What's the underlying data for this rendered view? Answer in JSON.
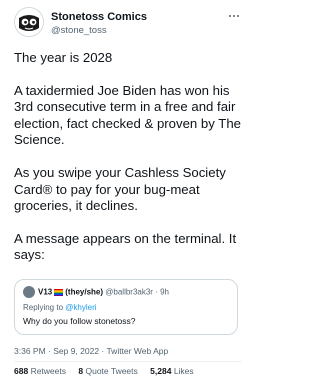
{
  "author": {
    "name": "Stonetoss Comics",
    "handle": "@stone_toss",
    "avatar_icon": "cartoon-face-avatar"
  },
  "tweet": {
    "paragraphs": [
      "The year is 2028",
      "A taxidermied Joe Biden has won his 3rd consecutive term in a free and fair election, fact checked & proven by The Science.",
      "As you swipe your Cashless Society Card® to pay for your bug-meat groceries, it declines.",
      "A message appears on the terminal. It says:"
    ]
  },
  "quote": {
    "name": "V13",
    "pronouns": "(they/she)",
    "handle": "@ballbr3ak3r",
    "time": "· 9h",
    "replying_prefix": "Replying to",
    "replying_handle": "@khyleri",
    "text": "Why do you follow stonetoss?",
    "flag_icon": "rainbow-flag-icon"
  },
  "timestamp": "3:36 PM · Sep 9, 2022 · Twitter Web App",
  "stats": {
    "retweets_count": "688",
    "retweets_label": "Retweets",
    "quotes_count": "8",
    "quotes_label": "Quote Tweets",
    "likes_count": "5,284",
    "likes_label": "Likes"
  },
  "colors": {
    "text": "#0f1419",
    "secondary": "#536471",
    "link": "#1d9bf0",
    "border": "#cfd9de"
  }
}
